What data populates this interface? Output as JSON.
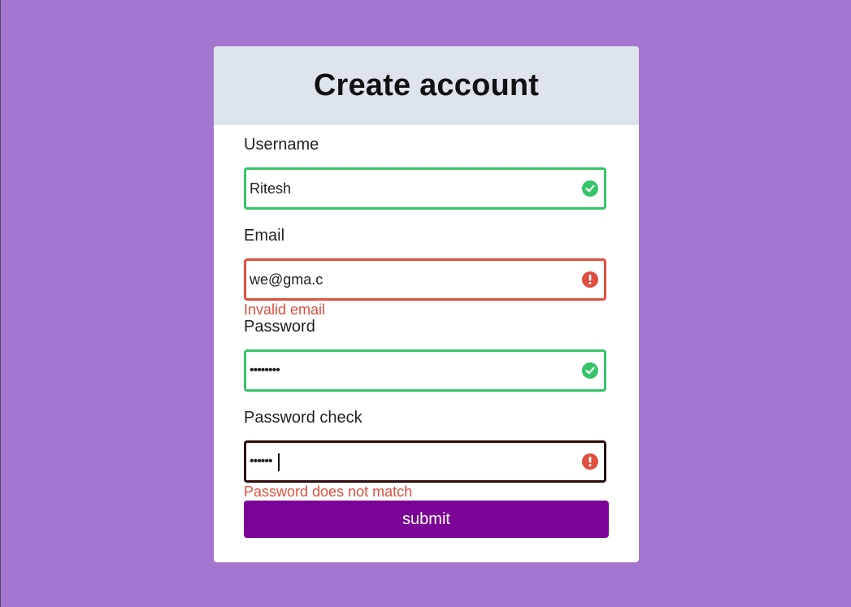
{
  "page": {
    "background_color": "#a576cf"
  },
  "form": {
    "title": "Create account",
    "fields": [
      {
        "label": "Username",
        "value": "Ritesh",
        "type": "text",
        "status": "valid",
        "icon": "check-circle-icon"
      },
      {
        "label": "Email",
        "value": "we@gma.c",
        "type": "text",
        "status": "invalid",
        "icon": "exclamation-circle-icon",
        "error": "Invalid email"
      },
      {
        "label": "Password",
        "value": "••••••••",
        "type": "password",
        "status": "valid",
        "icon": "check-circle-icon"
      },
      {
        "label": "Password check",
        "value": "••••••",
        "type": "password",
        "status": "invalid",
        "icon": "exclamation-circle-icon",
        "error": "Password does not match",
        "focused": true
      }
    ],
    "submit_label": "submit"
  },
  "colors": {
    "valid": "#35c46c",
    "invalid": "#e04f3f",
    "header_bg": "#dee4ec",
    "submit_bg": "#7b0497"
  }
}
